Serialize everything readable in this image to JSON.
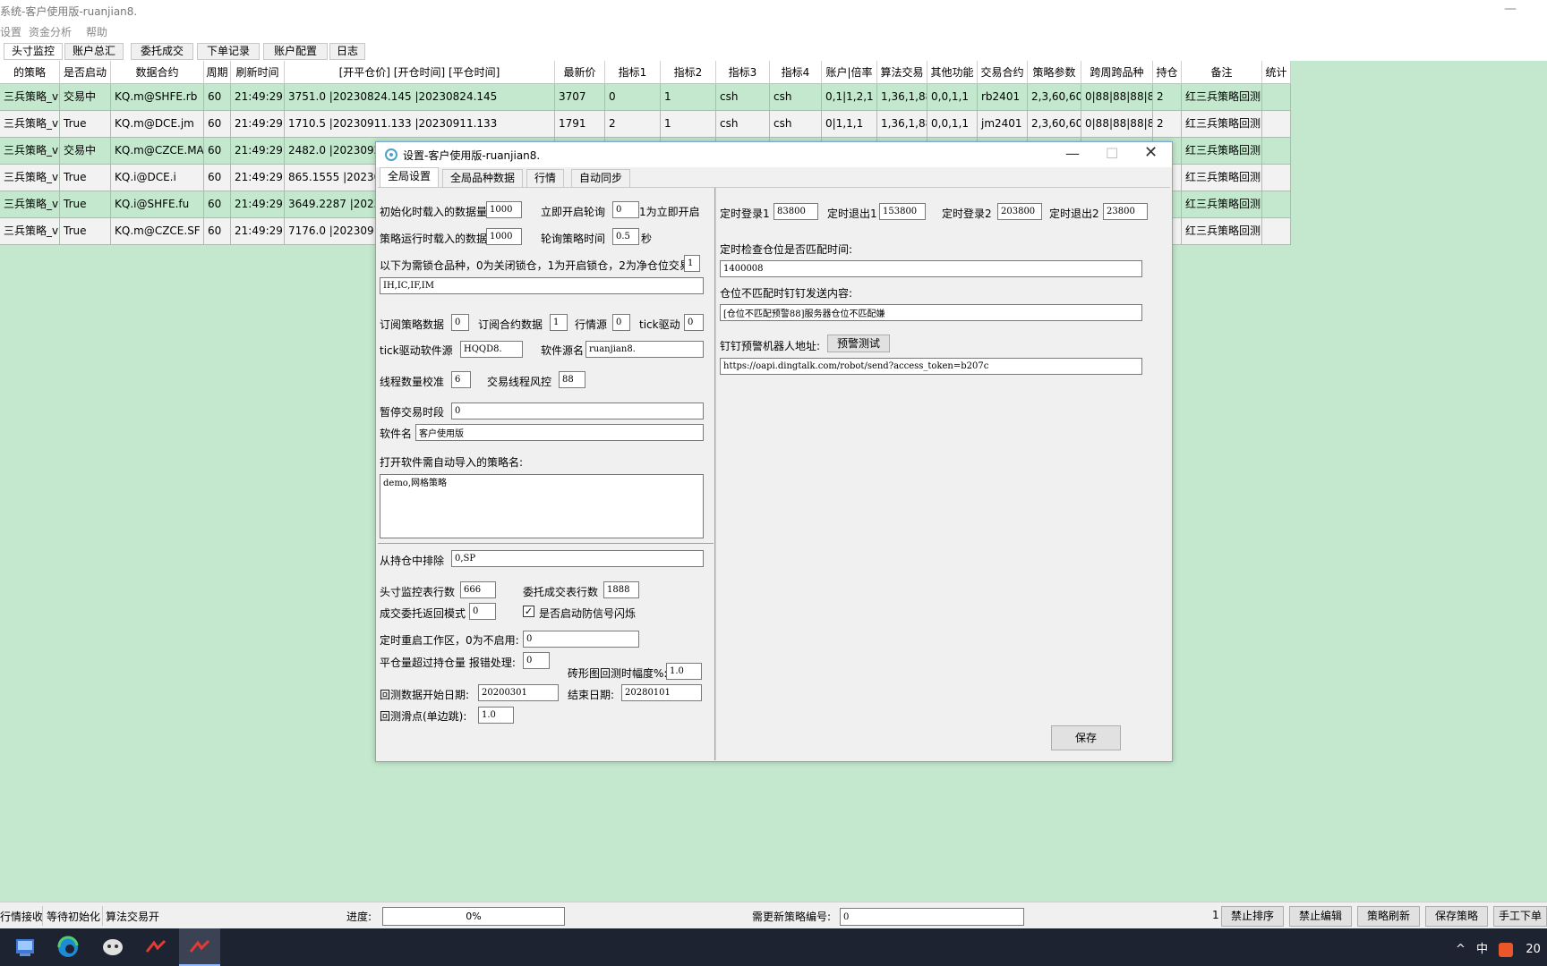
{
  "window": {
    "title": "系统-客户使用版-ruanjian8."
  },
  "menu": [
    "设置",
    "资金分析",
    "帮助"
  ],
  "main_tabs": [
    "头寸监控",
    "账户总汇",
    "委托成交",
    "下单记录",
    "账户配置",
    "日志"
  ],
  "grid": {
    "headers": [
      "的策略",
      "是否启动",
      "数据合约",
      "周期",
      "刷新时间",
      "[开平仓价] [开仓时间] [平仓时间]",
      "最新价",
      "指标1",
      "指标2",
      "指标3",
      "指标4",
      "账户|倍率",
      "算法交易",
      "其他功能",
      "交易合约",
      "策略参数",
      "跨周跨品种",
      "持仓",
      "备注",
      "统计"
    ],
    "rows": [
      [
        "三兵策略_v1",
        "交易中",
        "KQ.m@SHFE.rb",
        "60",
        "21:49:29",
        "3751.0 |20230824.145 |20230824.145",
        "3707",
        "0",
        "1",
        "csh",
        "csh",
        "0,1|1,2,1",
        "1,36,1,88",
        "0,0,1,1",
        "rb2401",
        "2,3,60,60",
        "0|88|88|88|88",
        "2",
        "红三兵策略回测",
        ""
      ],
      [
        "三兵策略_v1",
        "True",
        "KQ.m@DCE.jm",
        "60",
        "21:49:29",
        "1710.5 |20230911.133 |20230911.133",
        "1791",
        "2",
        "1",
        "csh",
        "csh",
        "0|1,1,1",
        "1,36,1,88",
        "0,0,1,1",
        "jm2401",
        "2,3,60,60",
        "0|88|88|88|88",
        "2",
        "红三兵策略回测",
        ""
      ],
      [
        "三兵策略_v1",
        "交易中",
        "KQ.m@CZCE.MA",
        "60",
        "21:49:29",
        "2482.0 |20230925",
        "",
        "",
        "",
        "",
        "",
        "",
        "",
        "",
        "",
        "",
        "",
        "",
        "红三兵策略回测",
        ""
      ],
      [
        "三兵策略_v1",
        "True",
        "KQ.i@DCE.i",
        "60",
        "21:49:29",
        "865.1555 |202309",
        "",
        "",
        "",
        "",
        "",
        "",
        "",
        "",
        "",
        "",
        "",
        "",
        "红三兵策略回测",
        ""
      ],
      [
        "三兵策略_v1",
        "True",
        "KQ.i@SHFE.fu",
        "60",
        "21:49:29",
        "3649.2287 |20230",
        "",
        "",
        "",
        "",
        "",
        "",
        "",
        "",
        "",
        "",
        "",
        "",
        "红三兵策略回测",
        ""
      ],
      [
        "三兵策略_v1",
        "True",
        "KQ.m@CZCE.SF",
        "60",
        "21:49:29",
        "7176.0 |20230911",
        "",
        "",
        "",
        "",
        "",
        "",
        "",
        "",
        "",
        "",
        "",
        "",
        "红三兵策略回测",
        ""
      ]
    ]
  },
  "dialog": {
    "title": "设置-客户使用版-ruanjian8.",
    "tabs": [
      "全局设置",
      "全局品种数据",
      "行情",
      "自动同步"
    ],
    "left": {
      "init_load_label": "初始化时载入的数据量",
      "init_load_value": "1000",
      "immediate_poll_label": "立即开启轮询",
      "immediate_poll_value": "0",
      "immediate_poll_note": "1为立即开启",
      "run_load_label": "策略运行时载入的数据",
      "run_load_value": "1000",
      "poll_time_label": "轮询策略时间",
      "poll_time_value": "0.5",
      "poll_time_unit": "秒",
      "lock_label": "以下为需锁仓品种，0为关闭锁仓，1为开启锁仓，2为净仓位交易",
      "lock_mode_value": "1",
      "lock_products_value": "IH,IC,IF,IM",
      "sub_strategy_label": "订阅策略数据",
      "sub_strategy_value": "0",
      "sub_contract_label": "订阅合约数据",
      "sub_contract_value": "1",
      "quote_source_label": "行情源",
      "quote_source_value": "0",
      "tick_drive_label": "tick驱动",
      "tick_drive_value": "0",
      "tick_source_label": "tick驱动软件源",
      "tick_source_value": "HQQD8.",
      "software_source_label": "软件源名",
      "software_source_value": "ruanjian8.",
      "thread_check_label": "线程数量校准",
      "thread_check_value": "6",
      "thread_risk_label": "交易线程风控",
      "thread_risk_value": "88",
      "pause_label": "暂停交易时段",
      "pause_value": "0",
      "soft_name_label": "软件名",
      "soft_name_value": "客户使用版",
      "auto_import_label": "打开软件需自动导入的策略名:",
      "auto_import_value": "demo,网格策略",
      "exclude_label": "从持仓中排除",
      "exclude_value": "0,SP",
      "pos_rows_label": "头寸监控表行数",
      "pos_rows_value": "666",
      "order_rows_label": "委托成交表行数",
      "order_rows_value": "1888",
      "fill_mode_label": "成交委托返回模式",
      "fill_mode_value": "0",
      "flash_label": "是否启动防信号闪烁",
      "flash_checked": "✓",
      "restart_label": "定时重启工作区，0为不启用:",
      "restart_value": "0",
      "over_close_label": "平仓量超过持仓量 报错处理:",
      "over_close_value": "0",
      "brick_label": "砖形图回测时幅度%:",
      "brick_value": "1.0",
      "bt_start_label": "回测数据开始日期:",
      "bt_start_value": "20200301",
      "bt_end_label": "结束日期:",
      "bt_end_value": "20280101",
      "slip_label": "回测滑点(单边跳):",
      "slip_value": "1.0"
    },
    "right": {
      "login1_label": "定时登录1",
      "login1_value": "83800",
      "logout1_label": "定时退出1",
      "logout1_value": "153800",
      "login2_label": "定时登录2",
      "login2_value": "203800",
      "logout2_label": "定时退出2",
      "logout2_value": "23800",
      "check_time_label": "定时检查仓位是否匹配时间:",
      "check_time_value": "1400008",
      "mismatch_label": "仓位不匹配时钉钉发送内容:",
      "mismatch_value": "[仓位不匹配预警88]服务器仓位不匹配嫌",
      "robot_label": "钉钉预警机器人地址:",
      "robot_test_button": "预警测试",
      "robot_value": "https://oapi.dingtalk.com/robot/send?access_token=b207c",
      "save_button": "保存"
    }
  },
  "status": {
    "items": [
      "行情接收",
      "等待初始化",
      "算法交易开"
    ],
    "progress_label": "进度:",
    "progress_text": "0%",
    "progress_value": 0,
    "strategy_no_label": "需更新策略编号:",
    "strategy_no_value": "0",
    "count": "1",
    "buttons": [
      "禁止排序",
      "禁止编辑",
      "策略刷新",
      "保存策略",
      "手工下单"
    ]
  },
  "taskbar": {
    "tray_ime": "中",
    "clock": "20"
  }
}
